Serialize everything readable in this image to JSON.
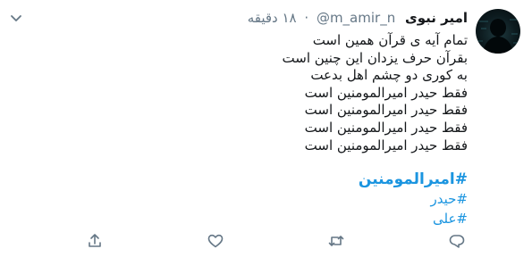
{
  "tweet": {
    "display_name": "امیر نبوی",
    "handle": "@m_amir_n",
    "separator": "·",
    "time": "۱۸ دقیقه",
    "lines": [
      "تمام آیه ی قرآن همین است",
      "بقرآن حرف یزدان این چنین است",
      "به کوری دو چشم اهل بدعت",
      "فقط حیدر امیرالمومنین است",
      "فقط حیدر امیرالمومنین است",
      "فقط حیدر امیرالمومنین است",
      "فقط حیدر امیرالمومنین است"
    ],
    "hashtags": {
      "main": "#امیرالمومنین",
      "second": "#حیدر",
      "third": "#علی"
    }
  },
  "icons": {
    "menu": "chevron-down-icon",
    "reply": "reply-icon",
    "retweet": "retweet-icon",
    "like": "heart-icon",
    "share": "share-icon"
  },
  "colors": {
    "link": "#1b95e0",
    "muted": "#657786",
    "text": "#14171a"
  }
}
